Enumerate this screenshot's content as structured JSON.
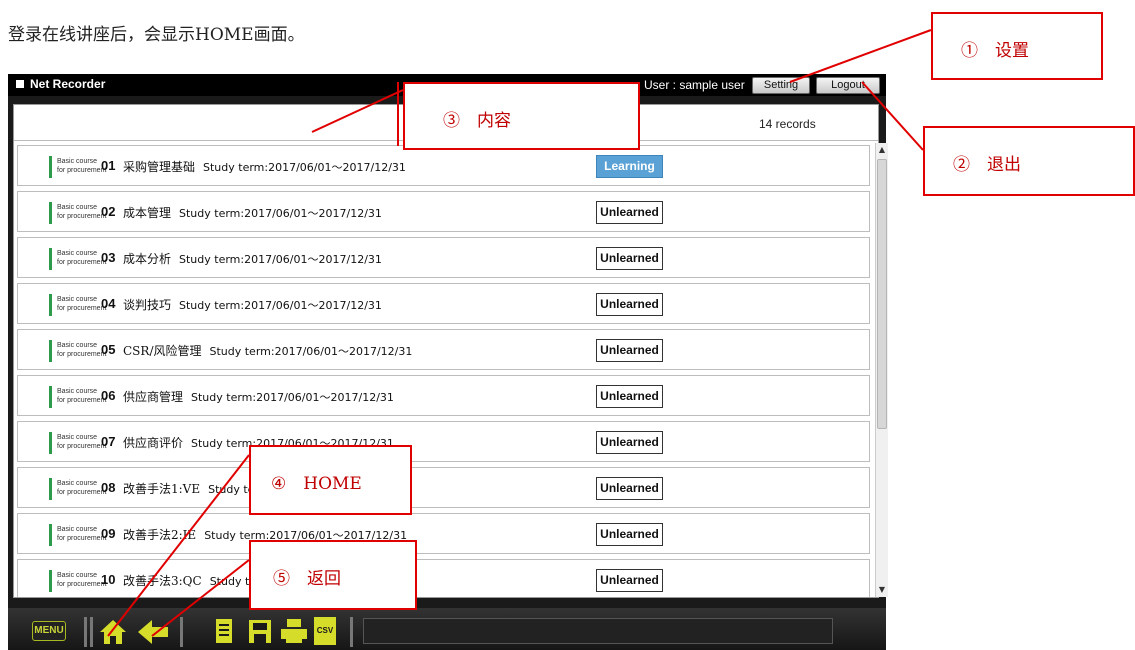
{
  "intro_text": "登录在线讲座后，会显示HOME画面。",
  "app": {
    "title": "Net Recorder",
    "user_label": "User : sample user",
    "setting_label": "Setting",
    "logout_label": "Logout",
    "records_label": "14 records"
  },
  "course_label_line1": "Basic course",
  "course_label_line2": "for procurement",
  "rows": [
    {
      "num": "01",
      "name": "采购管理基础",
      "term": "Study term:2017/06/01～2017/12/31",
      "status": "Learning"
    },
    {
      "num": "02",
      "name": "成本管理",
      "term": "Study term:2017/06/01～2017/12/31",
      "status": "Unlearned"
    },
    {
      "num": "03",
      "name": "成本分析",
      "term": "Study term:2017/06/01～2017/12/31",
      "status": "Unlearned"
    },
    {
      "num": "04",
      "name": "谈判技巧",
      "term": "Study term:2017/06/01～2017/12/31",
      "status": "Unlearned"
    },
    {
      "num": "05",
      "name": "CSR/风险管理",
      "term": "Study term:2017/06/01～2017/12/31",
      "status": "Unlearned"
    },
    {
      "num": "06",
      "name": "供应商管理",
      "term": "Study term:2017/06/01～2017/12/31",
      "status": "Unlearned"
    },
    {
      "num": "07",
      "name": "供应商评价",
      "term": "Study term:2017/06/01～2017/12/31",
      "status": "Unlearned"
    },
    {
      "num": "08",
      "name": "改善手法1:VE",
      "term": "Study term:2017/06/01～2017/12/31",
      "status": "Unlearned"
    },
    {
      "num": "09",
      "name": "改善手法2:IE",
      "term": "Study term:2017/06/01～2017/12/31",
      "status": "Unlearned"
    },
    {
      "num": "10",
      "name": "改善手法3:QC",
      "term": "Study term:2017/06/01～2017/12/31",
      "status": "Unlearned"
    }
  ],
  "toolbar": {
    "menu_label": "MENU",
    "csv_label": "CSV",
    "icons": [
      "home-icon",
      "back-arrow-icon",
      "document-icon",
      "save-icon",
      "print-icon",
      "csv-icon"
    ]
  },
  "callouts": {
    "c1": "①　设置",
    "c2": "②　退出",
    "c3": "③　内容",
    "c4": "④　HOME",
    "c5": "⑤　返回"
  },
  "colors": {
    "accent_green": "#2e9b4c",
    "learning_blue": "#5aa1d6",
    "callout_red": "#e10000",
    "toolbar_icon_yellow": "#d6dc2a"
  }
}
